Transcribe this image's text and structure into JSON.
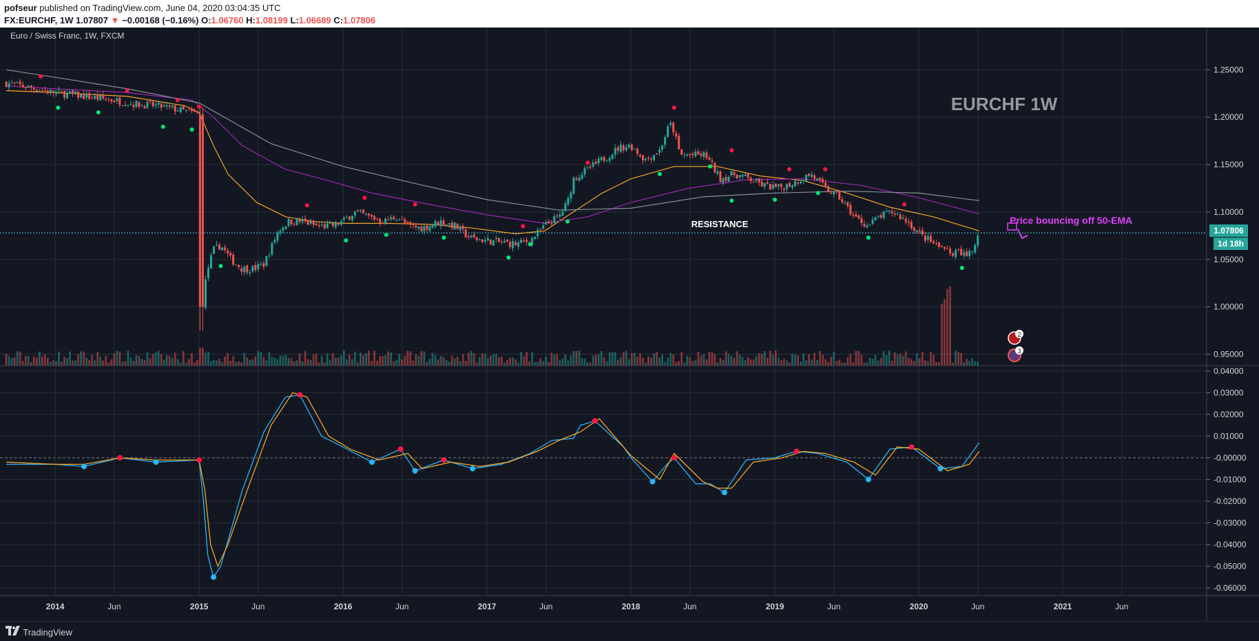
{
  "header": {
    "user": "pofseur",
    "published": "published on TradingView.com, June 04, 2020 03:04:35 UTC",
    "symbol": "FX:EURCHF, 1W",
    "last": "1.07807",
    "change": "−0.00168 (−0.16%)",
    "o_label": "O:",
    "o_val": "1.06760",
    "h_label": "H:",
    "h_val": "1.08199",
    "l_label": "L:",
    "l_val": "1.06689",
    "c_label": "C:",
    "c_val": "1.07806"
  },
  "chart": {
    "legend": "Euro / Swiss Franc, 1W, FXCM",
    "watermark": "EURCHF 1W",
    "resistance_label": "RESISTANCE",
    "annotation": "Price bouncing off 50-EMA",
    "price_badge": "1.07806",
    "time_badge": "1d 18h",
    "marker_2": "2",
    "marker_3": "3"
  },
  "footer": {
    "brand": "TradingView"
  },
  "colors": {
    "background": "#131722",
    "grid": "#2a2e39",
    "up": "#26a69a",
    "down": "#ef5350",
    "ema50": "#f5a623",
    "ema100": "#9c27b0",
    "ema200": "#8a8d96",
    "indicator_fast": "#29b6f6",
    "indicator_slow": "#f5a623",
    "annotation": "#e040fb",
    "badge": "#26a69a",
    "dot_green": "#00e676",
    "dot_red": "#ff1744"
  },
  "chart_data": {
    "type": "line",
    "title": "Euro / Swiss Franc, 1W, FXCM",
    "price_axis": {
      "ticks": [
        1.25,
        1.2,
        1.15,
        1.1,
        1.05,
        1.0,
        0.95
      ],
      "tick_labels": [
        "1.25000",
        "1.20000",
        "1.15000",
        "1.10000",
        "1.05000",
        "1.00000",
        "0.95000"
      ]
    },
    "indicator_axis": {
      "ticks": [
        0.04,
        0.03,
        0.02,
        0.01,
        0.0,
        -0.01,
        -0.02,
        -0.03,
        -0.04,
        -0.05,
        -0.06
      ],
      "tick_labels": [
        "0.04000",
        "0.03000",
        "0.02000",
        "0.01000",
        "-0.00000",
        "-0.01000",
        "-0.02000",
        "-0.03000",
        "-0.04000",
        "-0.05000",
        "-0.06000"
      ]
    },
    "time_axis": {
      "tick_labels": [
        "2014",
        "Jun",
        "2015",
        "Jun",
        "2016",
        "Jun",
        "2017",
        "Jun",
        "2018",
        "Jun",
        "2019",
        "Jun",
        "2020",
        "Jun",
        "2021",
        "Jun"
      ],
      "tick_years": [
        2014.0,
        2014.41,
        2015.0,
        2015.41,
        2016.0,
        2016.41,
        2017.0,
        2017.41,
        2018.0,
        2018.41,
        2019.0,
        2019.41,
        2020.0,
        2020.41,
        2021.0,
        2021.41
      ]
    },
    "x_range": [
      2013.65,
      2022.0
    ],
    "price_range": [
      0.938,
      1.28
    ],
    "indicator_range": [
      -0.0635,
      0.0425
    ],
    "resistance_level": 1.078,
    "price_path": [
      [
        2013.66,
        1.236
      ],
      [
        2013.8,
        1.232
      ],
      [
        2013.95,
        1.227
      ],
      [
        2014.1,
        1.224
      ],
      [
        2014.25,
        1.221
      ],
      [
        2014.4,
        1.218
      ],
      [
        2014.55,
        1.214
      ],
      [
        2014.7,
        1.212
      ],
      [
        2014.85,
        1.208
      ],
      [
        2015.0,
        1.203
      ],
      [
        2015.01,
        0.99
      ],
      [
        2015.02,
        1.005
      ],
      [
        2015.06,
        1.04
      ],
      [
        2015.1,
        1.06
      ],
      [
        2015.15,
        1.065
      ],
      [
        2015.22,
        1.05
      ],
      [
        2015.3,
        1.04
      ],
      [
        2015.38,
        1.04
      ],
      [
        2015.45,
        1.045
      ],
      [
        2015.55,
        1.08
      ],
      [
        2015.62,
        1.09
      ],
      [
        2015.72,
        1.09
      ],
      [
        2015.82,
        1.085
      ],
      [
        2015.92,
        1.085
      ],
      [
        2016.0,
        1.09
      ],
      [
        2016.08,
        1.1
      ],
      [
        2016.18,
        1.095
      ],
      [
        2016.28,
        1.09
      ],
      [
        2016.38,
        1.095
      ],
      [
        2016.45,
        1.085
      ],
      [
        2016.55,
        1.083
      ],
      [
        2016.68,
        1.09
      ],
      [
        2016.78,
        1.085
      ],
      [
        2016.88,
        1.073
      ],
      [
        2016.98,
        1.07
      ],
      [
        2017.1,
        1.068
      ],
      [
        2017.2,
        1.066
      ],
      [
        2017.3,
        1.07
      ],
      [
        2017.42,
        1.088
      ],
      [
        2017.5,
        1.095
      ],
      [
        2017.56,
        1.11
      ],
      [
        2017.6,
        1.135
      ],
      [
        2017.7,
        1.145
      ],
      [
        2017.8,
        1.155
      ],
      [
        2017.92,
        1.168
      ],
      [
        2018.0,
        1.17
      ],
      [
        2018.1,
        1.155
      ],
      [
        2018.2,
        1.165
      ],
      [
        2018.27,
        1.193
      ],
      [
        2018.3,
        1.185
      ],
      [
        2018.34,
        1.16
      ],
      [
        2018.45,
        1.16
      ],
      [
        2018.52,
        1.16
      ],
      [
        2018.62,
        1.135
      ],
      [
        2018.72,
        1.14
      ],
      [
        2018.82,
        1.135
      ],
      [
        2018.92,
        1.128
      ],
      [
        2019.02,
        1.125
      ],
      [
        2019.12,
        1.13
      ],
      [
        2019.25,
        1.14
      ],
      [
        2019.35,
        1.125
      ],
      [
        2019.45,
        1.115
      ],
      [
        2019.55,
        1.095
      ],
      [
        2019.65,
        1.085
      ],
      [
        2019.72,
        1.095
      ],
      [
        2019.82,
        1.1
      ],
      [
        2019.92,
        1.09
      ],
      [
        2020.02,
        1.075
      ],
      [
        2020.12,
        1.065
      ],
      [
        2020.22,
        1.058
      ],
      [
        2020.32,
        1.055
      ],
      [
        2020.38,
        1.06
      ],
      [
        2020.42,
        1.078
      ]
    ],
    "series": [
      {
        "name": "",
        "points": [
          [
            2013.66,
            1.228
          ],
          [
            2014.0,
            1.226
          ],
          [
            2014.5,
            1.222
          ],
          [
            2014.9,
            1.212
          ],
          [
            2015.0,
            1.205
          ],
          [
            2015.1,
            1.17
          ],
          [
            2015.2,
            1.14
          ],
          [
            2015.4,
            1.11
          ],
          [
            2015.6,
            1.095
          ],
          [
            2015.8,
            1.09
          ],
          [
            2016.0,
            1.088
          ],
          [
            2016.3,
            1.088
          ],
          [
            2016.6,
            1.087
          ],
          [
            2016.9,
            1.083
          ],
          [
            2017.2,
            1.077
          ],
          [
            2017.4,
            1.08
          ],
          [
            2017.6,
            1.1
          ],
          [
            2017.8,
            1.12
          ],
          [
            2018.0,
            1.135
          ],
          [
            2018.3,
            1.148
          ],
          [
            2018.6,
            1.148
          ],
          [
            2018.9,
            1.138
          ],
          [
            2019.2,
            1.133
          ],
          [
            2019.5,
            1.12
          ],
          [
            2019.8,
            1.105
          ],
          [
            2020.1,
            1.095
          ],
          [
            2020.42,
            1.08
          ]
        ]
      },
      {
        "name": "",
        "points": [
          [
            2013.66,
            1.233
          ],
          [
            2014.0,
            1.23
          ],
          [
            2014.5,
            1.226
          ],
          [
            2014.95,
            1.218
          ],
          [
            2015.1,
            1.2
          ],
          [
            2015.3,
            1.17
          ],
          [
            2015.6,
            1.145
          ],
          [
            2015.9,
            1.133
          ],
          [
            2016.2,
            1.12
          ],
          [
            2016.6,
            1.108
          ],
          [
            2017.0,
            1.097
          ],
          [
            2017.4,
            1.088
          ],
          [
            2017.7,
            1.095
          ],
          [
            2018.0,
            1.11
          ],
          [
            2018.4,
            1.125
          ],
          [
            2018.8,
            1.134
          ],
          [
            2019.2,
            1.135
          ],
          [
            2019.6,
            1.128
          ],
          [
            2020.0,
            1.115
          ],
          [
            2020.42,
            1.098
          ]
        ]
      },
      {
        "name": "",
        "points": [
          [
            2013.66,
            1.25
          ],
          [
            2014.0,
            1.242
          ],
          [
            2014.5,
            1.23
          ],
          [
            2015.0,
            1.215
          ],
          [
            2015.5,
            1.172
          ],
          [
            2016.0,
            1.148
          ],
          [
            2016.5,
            1.13
          ],
          [
            2017.0,
            1.113
          ],
          [
            2017.5,
            1.102
          ],
          [
            2018.0,
            1.104
          ],
          [
            2018.5,
            1.116
          ],
          [
            2019.0,
            1.12
          ],
          [
            2019.5,
            1.122
          ],
          [
            2020.0,
            1.12
          ],
          [
            2020.42,
            1.112
          ]
        ]
      }
    ],
    "indicator_fast": [
      [
        2013.66,
        -0.003
      ],
      [
        2014.0,
        -0.003
      ],
      [
        2014.2,
        -0.004
      ],
      [
        2014.45,
        0.0
      ],
      [
        2014.7,
        -0.002
      ],
      [
        2015.0,
        -0.001
      ],
      [
        2015.03,
        -0.02
      ],
      [
        2015.06,
        -0.045
      ],
      [
        2015.1,
        -0.055
      ],
      [
        2015.15,
        -0.05
      ],
      [
        2015.3,
        -0.015
      ],
      [
        2015.45,
        0.012
      ],
      [
        2015.6,
        0.028
      ],
      [
        2015.7,
        0.029
      ],
      [
        2015.85,
        0.01
      ],
      [
        2016.0,
        0.005
      ],
      [
        2016.2,
        -0.002
      ],
      [
        2016.4,
        0.004
      ],
      [
        2016.5,
        -0.006
      ],
      [
        2016.7,
        -0.001
      ],
      [
        2016.9,
        -0.005
      ],
      [
        2017.1,
        -0.003
      ],
      [
        2017.3,
        0.002
      ],
      [
        2017.45,
        0.008
      ],
      [
        2017.6,
        0.009
      ],
      [
        2017.65,
        0.015
      ],
      [
        2017.75,
        0.017
      ],
      [
        2017.95,
        0.005
      ],
      [
        2018.0,
        0.0
      ],
      [
        2018.15,
        -0.011
      ],
      [
        2018.25,
        -0.003
      ],
      [
        2018.3,
        0.0
      ],
      [
        2018.45,
        -0.012
      ],
      [
        2018.55,
        -0.012
      ],
      [
        2018.65,
        -0.016
      ],
      [
        2018.8,
        -0.001
      ],
      [
        2019.0,
        0.0
      ],
      [
        2019.15,
        0.003
      ],
      [
        2019.3,
        0.002
      ],
      [
        2019.5,
        -0.002
      ],
      [
        2019.65,
        -0.01
      ],
      [
        2019.8,
        0.004
      ],
      [
        2019.95,
        0.005
      ],
      [
        2020.15,
        -0.005
      ],
      [
        2020.3,
        -0.004
      ],
      [
        2020.42,
        0.007
      ]
    ],
    "indicator_slow": [
      [
        2013.66,
        -0.002
      ],
      [
        2014.0,
        -0.003
      ],
      [
        2014.2,
        -0.003
      ],
      [
        2014.45,
        0.0
      ],
      [
        2014.7,
        -0.001
      ],
      [
        2015.0,
        -0.001
      ],
      [
        2015.04,
        -0.015
      ],
      [
        2015.08,
        -0.04
      ],
      [
        2015.13,
        -0.05
      ],
      [
        2015.2,
        -0.04
      ],
      [
        2015.35,
        -0.012
      ],
      [
        2015.5,
        0.015
      ],
      [
        2015.65,
        0.03
      ],
      [
        2015.75,
        0.028
      ],
      [
        2015.9,
        0.01
      ],
      [
        2016.05,
        0.004
      ],
      [
        2016.25,
        -0.001
      ],
      [
        2016.45,
        0.002
      ],
      [
        2016.55,
        -0.005
      ],
      [
        2016.75,
        -0.002
      ],
      [
        2016.95,
        -0.004
      ],
      [
        2017.15,
        -0.002
      ],
      [
        2017.35,
        0.003
      ],
      [
        2017.5,
        0.008
      ],
      [
        2017.65,
        0.012
      ],
      [
        2017.78,
        0.018
      ],
      [
        2018.0,
        0.001
      ],
      [
        2018.2,
        -0.01
      ],
      [
        2018.3,
        0.002
      ],
      [
        2018.5,
        -0.011
      ],
      [
        2018.6,
        -0.014
      ],
      [
        2018.7,
        -0.014
      ],
      [
        2018.85,
        -0.002
      ],
      [
        2019.05,
        0.0
      ],
      [
        2019.2,
        0.003
      ],
      [
        2019.35,
        0.002
      ],
      [
        2019.55,
        -0.002
      ],
      [
        2019.7,
        -0.008
      ],
      [
        2019.85,
        0.005
      ],
      [
        2020.0,
        0.004
      ],
      [
        2020.2,
        -0.006
      ],
      [
        2020.35,
        -0.003
      ],
      [
        2020.42,
        0.003
      ]
    ]
  }
}
